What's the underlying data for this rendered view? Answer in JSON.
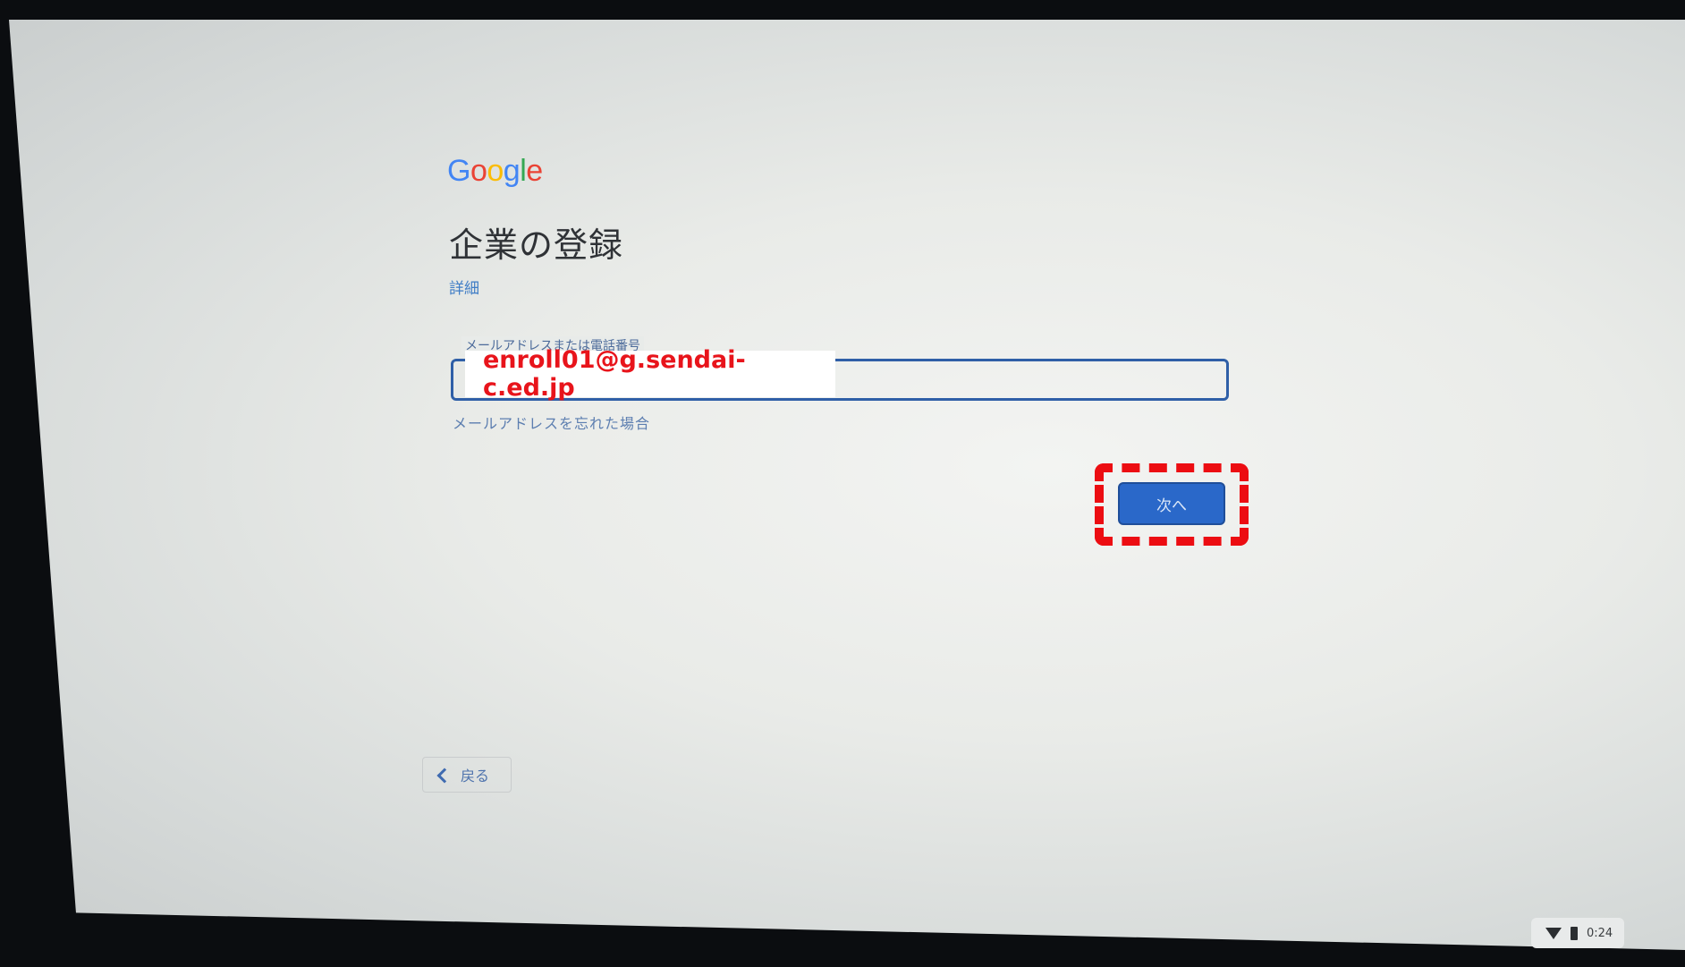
{
  "logo": {
    "letters": [
      {
        "char": "G",
        "color": "#4285F4"
      },
      {
        "char": "o",
        "color": "#EA4335"
      },
      {
        "char": "o",
        "color": "#FBBC05"
      },
      {
        "char": "g",
        "color": "#4285F4"
      },
      {
        "char": "l",
        "color": "#34A853"
      },
      {
        "char": "e",
        "color": "#EA4335"
      }
    ]
  },
  "page": {
    "title": "企業の登録",
    "learn_more": "詳細"
  },
  "email_field": {
    "label": "メールアドレスまたは電話番号",
    "value": "enroll01@g.sendai-c.ed.jp"
  },
  "forgot_email_link": "メールアドレスを忘れた場合",
  "next_button": {
    "label": "次へ"
  },
  "back_button": {
    "label": "戻る"
  },
  "status_tray": {
    "time": "0:24",
    "icons": [
      "wifi-icon",
      "battery-icon"
    ]
  },
  "colors": {
    "accent": "#2a68c9",
    "highlight": "#ec0d12",
    "overlay_text": "#e8141b"
  }
}
